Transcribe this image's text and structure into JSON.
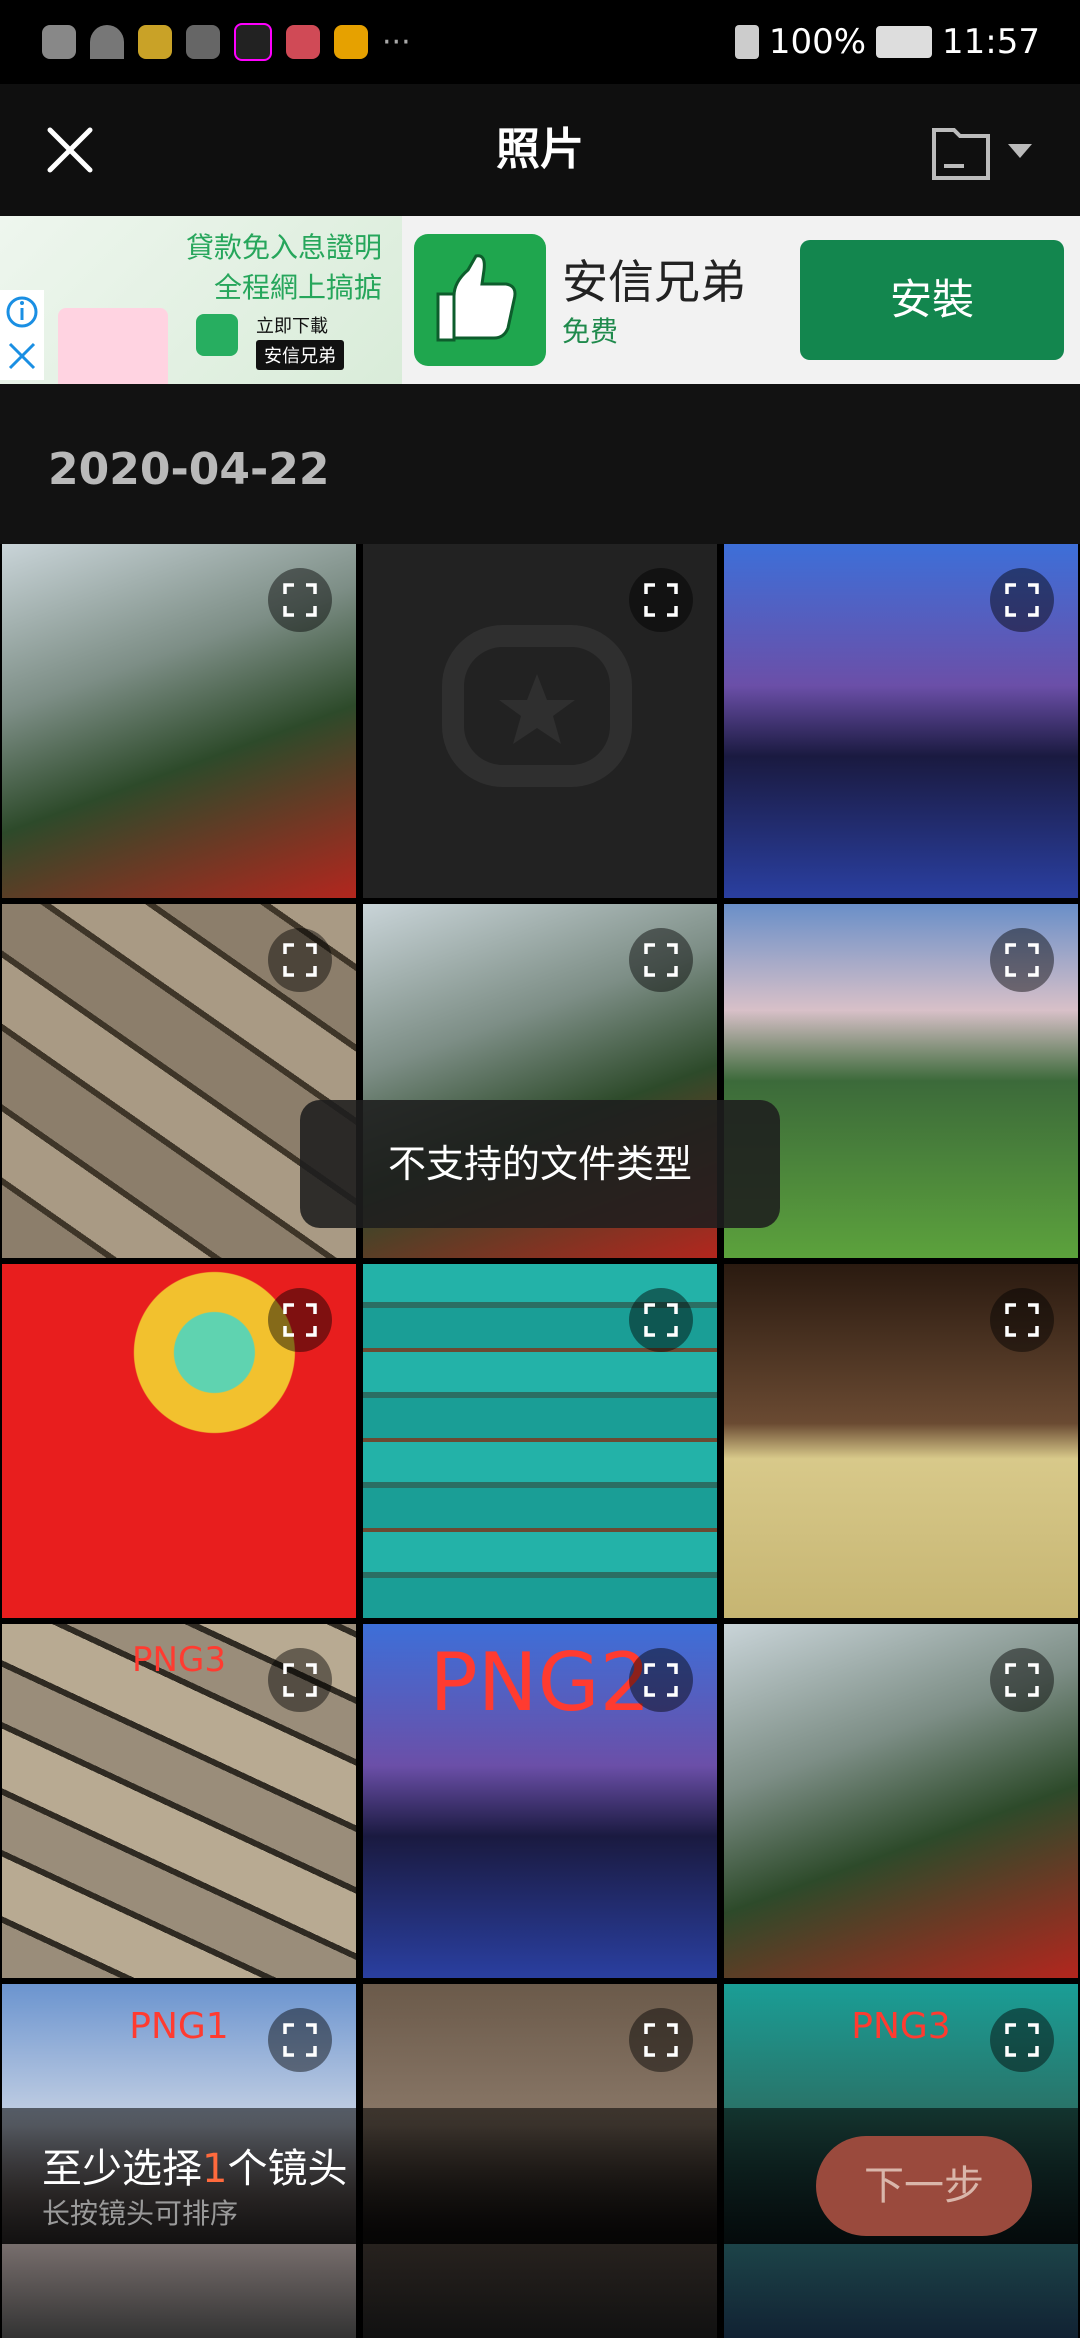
{
  "status_bar": {
    "battery": "100%",
    "time": "11:57"
  },
  "header": {
    "title": "照片"
  },
  "ad": {
    "image_line1": "貸款免入息證明",
    "image_line2": "全程網上搞掂",
    "download_text": "立即下載",
    "brand_chip": "安信兄弟",
    "app_name": "安信兄弟",
    "price": "免费",
    "install_label": "安裝"
  },
  "gallery": {
    "date": "2020-04-22",
    "tiles": [
      {
        "overlay": ""
      },
      {
        "overlay": ""
      },
      {
        "overlay": ""
      },
      {
        "overlay": ""
      },
      {
        "overlay": ""
      },
      {
        "overlay": ""
      },
      {
        "overlay": ""
      },
      {
        "overlay": ""
      },
      {
        "overlay": ""
      },
      {
        "overlay": "PNG3"
      },
      {
        "overlay": "PNG2"
      },
      {
        "overlay": ""
      },
      {
        "overlay": "PNG1"
      },
      {
        "overlay": ""
      },
      {
        "overlay": "PNG3"
      }
    ]
  },
  "toast": {
    "message": "不支持的文件类型"
  },
  "bottom": {
    "hint_prefix": "至少选择",
    "hint_count": "1",
    "hint_suffix": "个镜头",
    "sub_hint": "长按镜头可排序",
    "next_label": "下一步"
  },
  "colors": {
    "accent": "#ff6a3d",
    "install_green": "#13864e"
  }
}
